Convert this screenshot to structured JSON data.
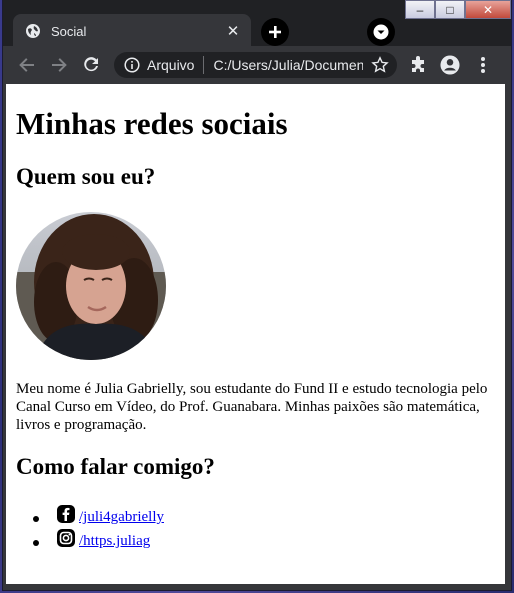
{
  "window": {
    "minimize": "–",
    "maximize": "□",
    "close": "✕"
  },
  "tab": {
    "title": "Social",
    "close": "✕"
  },
  "toolbar": {
    "omnibox_label": "Arquivo",
    "url": "C:/Users/Julia/Documents/..."
  },
  "page": {
    "title": "Minhas redes sociais",
    "about_heading": "Quem sou eu?",
    "bio": "Meu nome é Julia Gabrielly, sou estudante do Fund II e estudo tecnologia pelo Canal Curso em Vídeo, do Prof. Guanabara. Minhas paixões são matemática, livros e programação.",
    "contact_heading": "Como falar comigo?",
    "links": [
      {
        "icon": "facebook-icon",
        "text": "/juli4gabrielly"
      },
      {
        "icon": "instagram-icon",
        "text": "/https.juliag"
      }
    ]
  }
}
